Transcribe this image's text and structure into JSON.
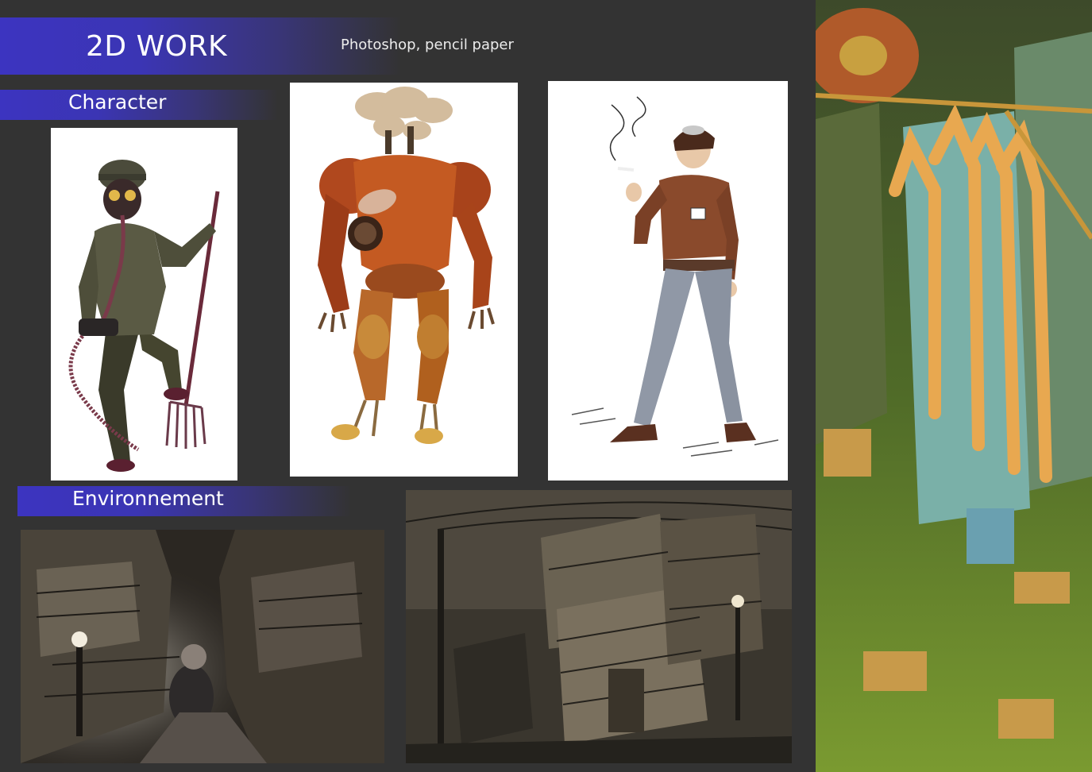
{
  "header": {
    "title": "2D WORK",
    "subtitle": "Photoshop, pencil paper"
  },
  "sections": {
    "character": "Character",
    "environment": "Environnement"
  },
  "colors": {
    "background": "#333333",
    "accent_band": "#3c34c0",
    "card": "#ffffff"
  }
}
